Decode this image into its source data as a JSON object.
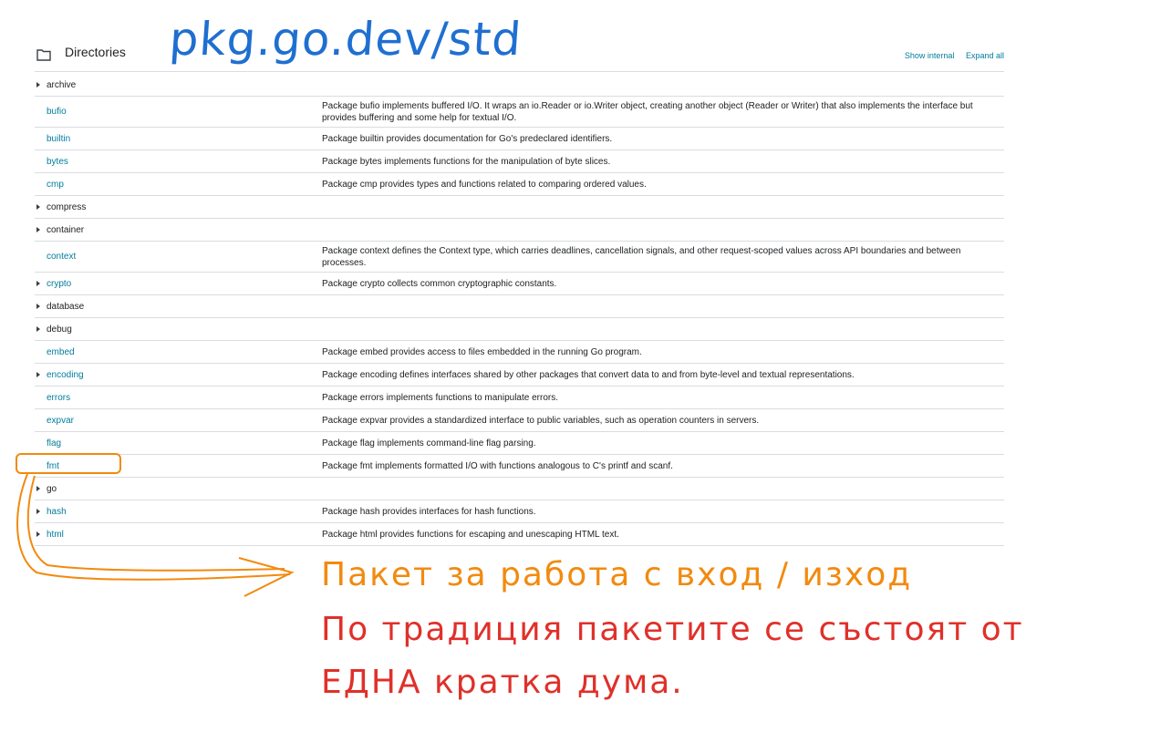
{
  "header": {
    "title": "Directories",
    "show_internal": "Show internal",
    "expand_all": "Expand all"
  },
  "handwritten_title": "pkg.go.dev/std",
  "rows": [
    {
      "name": "archive",
      "expandable": true,
      "link": false,
      "desc": ""
    },
    {
      "name": "bufio",
      "expandable": false,
      "link": true,
      "desc": "Package bufio implements buffered I/O. It wraps an io.Reader or io.Writer object, creating another object (Reader or Writer) that also implements the interface but provides buffering and some help for textual I/O."
    },
    {
      "name": "builtin",
      "expandable": false,
      "link": true,
      "desc": "Package builtin provides documentation for Go's predeclared identifiers."
    },
    {
      "name": "bytes",
      "expandable": false,
      "link": true,
      "desc": "Package bytes implements functions for the manipulation of byte slices."
    },
    {
      "name": "cmp",
      "expandable": false,
      "link": true,
      "desc": "Package cmp provides types and functions related to comparing ordered values."
    },
    {
      "name": "compress",
      "expandable": true,
      "link": false,
      "desc": ""
    },
    {
      "name": "container",
      "expandable": true,
      "link": false,
      "desc": ""
    },
    {
      "name": "context",
      "expandable": false,
      "link": true,
      "desc": "Package context defines the Context type, which carries deadlines, cancellation signals, and other request-scoped values across API boundaries and between processes."
    },
    {
      "name": "crypto",
      "expandable": true,
      "link": true,
      "desc": "Package crypto collects common cryptographic constants."
    },
    {
      "name": "database",
      "expandable": true,
      "link": false,
      "desc": ""
    },
    {
      "name": "debug",
      "expandable": true,
      "link": false,
      "desc": ""
    },
    {
      "name": "embed",
      "expandable": false,
      "link": true,
      "desc": "Package embed provides access to files embedded in the running Go program."
    },
    {
      "name": "encoding",
      "expandable": true,
      "link": true,
      "desc": "Package encoding defines interfaces shared by other packages that convert data to and from byte-level and textual representations."
    },
    {
      "name": "errors",
      "expandable": false,
      "link": true,
      "desc": "Package errors implements functions to manipulate errors."
    },
    {
      "name": "expvar",
      "expandable": false,
      "link": true,
      "desc": "Package expvar provides a standardized interface to public variables, such as operation counters in servers."
    },
    {
      "name": "flag",
      "expandable": false,
      "link": true,
      "desc": "Package flag implements command-line flag parsing."
    },
    {
      "name": "fmt",
      "expandable": false,
      "link": true,
      "desc": "Package fmt implements formatted I/O with functions analogous to C's printf and scanf."
    },
    {
      "name": "go",
      "expandable": true,
      "link": false,
      "desc": ""
    },
    {
      "name": "hash",
      "expandable": true,
      "link": true,
      "desc": "Package hash provides interfaces for hash functions."
    },
    {
      "name": "html",
      "expandable": true,
      "link": true,
      "desc": "Package html provides functions for escaping and unescaping HTML text."
    }
  ],
  "annotation": {
    "line1": "Пакет за работа с вход / изход",
    "line2": "По традиция пакетите се състоят от",
    "line3": "ЕДНА кратка дума."
  }
}
